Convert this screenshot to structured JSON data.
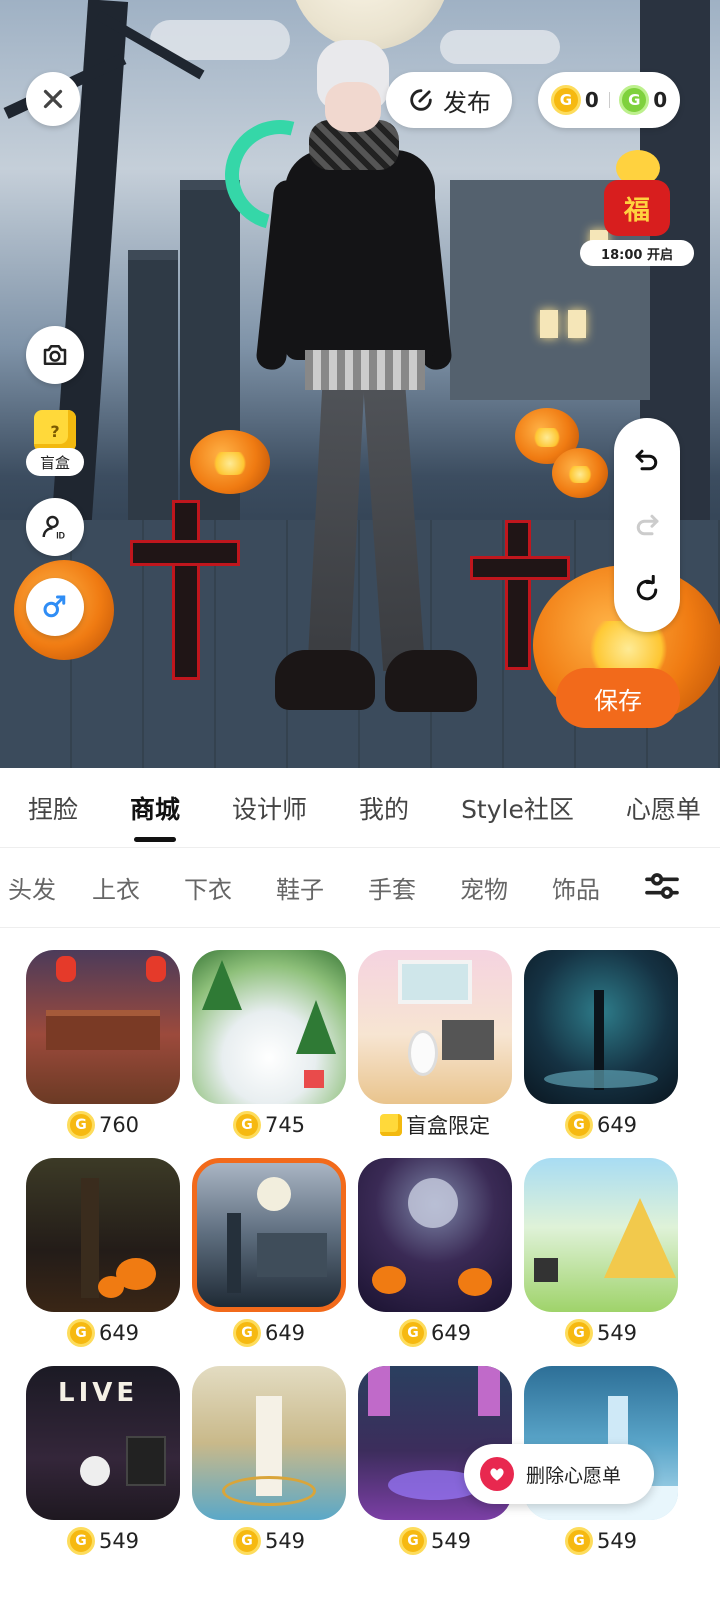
{
  "top_bar": {
    "close_icon": "close-icon",
    "publish_label": "发布",
    "gold_coin_glyph": "G",
    "gold_coin_count": "0",
    "green_coin_glyph": "G",
    "green_coin_count": "0"
  },
  "event_badge": {
    "mascot_text": "福",
    "time_label": "18:00 开启"
  },
  "left_tools": {
    "camera_icon": "camera-icon",
    "blindbox_label": "盲盒",
    "blindbox_glyph": "?",
    "profile_id_icon": "user-id-icon",
    "gender_icon": "male-gender-switch-icon"
  },
  "right_tools": {
    "undo_icon": "undo-icon",
    "redo_icon": "redo-icon",
    "reset_icon": "reset-icon",
    "save_label": "保存"
  },
  "main_tabs": [
    {
      "label": "捏脸",
      "active": false
    },
    {
      "label": "商城",
      "active": true
    },
    {
      "label": "设计师",
      "active": false
    },
    {
      "label": "我的",
      "active": false
    },
    {
      "label": "Style社区",
      "active": false
    },
    {
      "label": "心愿单",
      "active": false
    }
  ],
  "sub_tabs": [
    "头发",
    "上衣",
    "下衣",
    "鞋子",
    "手套",
    "宠物",
    "饰品"
  ],
  "items": [
    {
      "price": "760",
      "kind": "coin"
    },
    {
      "price": "745",
      "kind": "coin"
    },
    {
      "price": "盲盒限定",
      "kind": "blindbox"
    },
    {
      "price": "649",
      "kind": "coin"
    },
    {
      "price": "649",
      "kind": "coin"
    },
    {
      "price": "649",
      "kind": "coin",
      "selected": true
    },
    {
      "price": "649",
      "kind": "coin"
    },
    {
      "price": "549",
      "kind": "coin"
    },
    {
      "price": "549",
      "kind": "coin",
      "thumb_text": "LIVE"
    },
    {
      "price": "549",
      "kind": "coin"
    },
    {
      "price": "549",
      "kind": "coin"
    },
    {
      "price": "549",
      "kind": "coin"
    }
  ],
  "wishlist": {
    "label": "删除心愿单"
  },
  "colors": {
    "accent_orange": "#f26a1b",
    "coin_gold": "#f6b911",
    "coin_green": "#7fd13d",
    "heart_red": "#e8284f"
  }
}
